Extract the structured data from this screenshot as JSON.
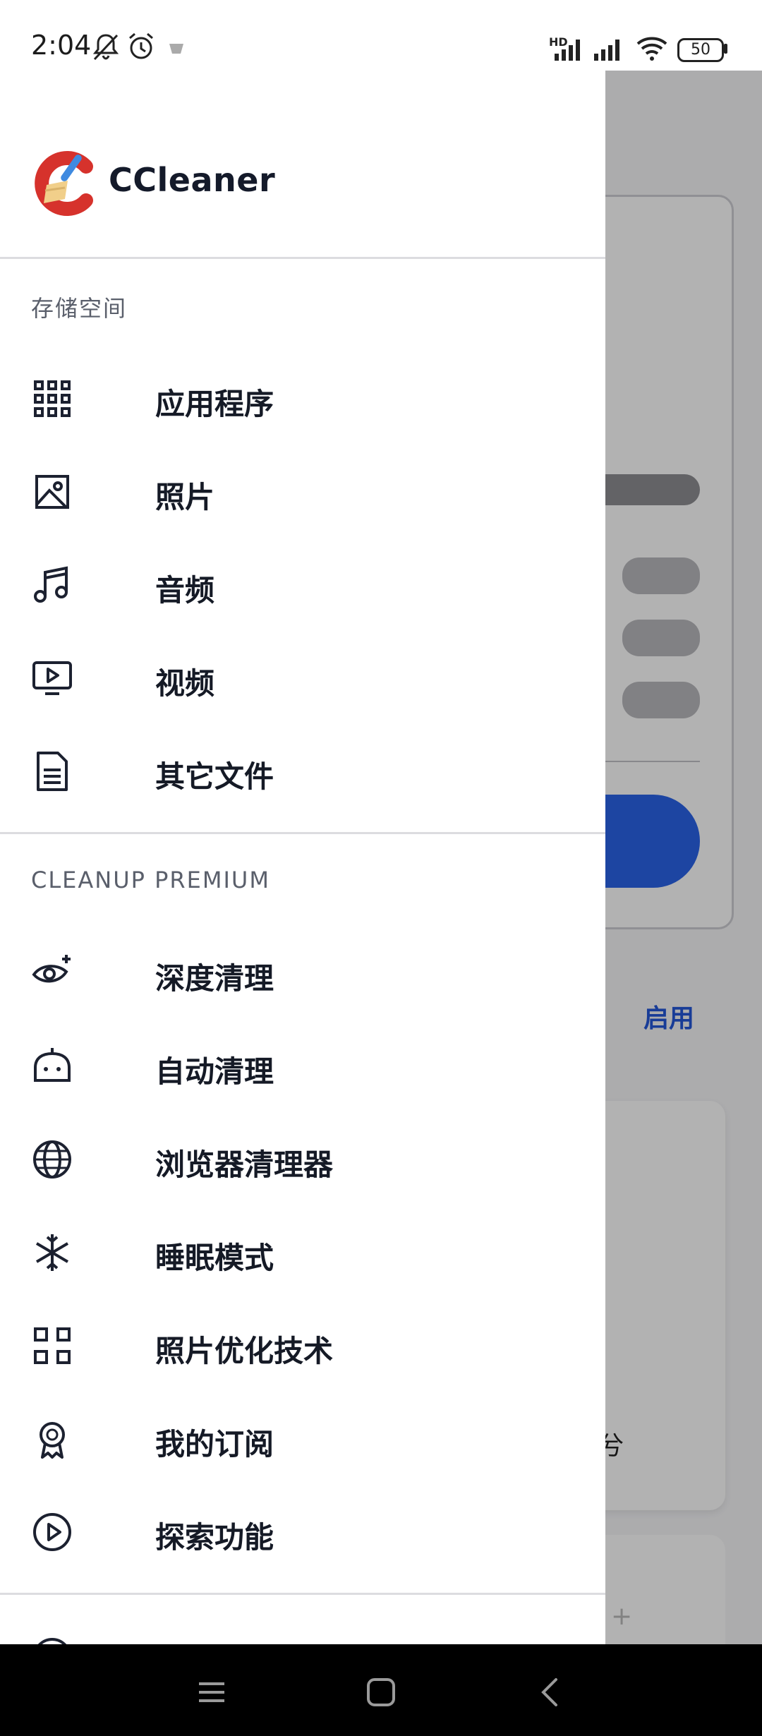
{
  "status_bar": {
    "time": "2:04",
    "battery_level": "50",
    "network_badge": "HD",
    "icons": [
      "bell-muted-icon",
      "alarm-icon",
      "notification-app-icon",
      "signal-hd-icon",
      "signal-icon",
      "wifi-icon",
      "battery-icon"
    ]
  },
  "drawer": {
    "brand": {
      "name": "CCleaner",
      "logo_icon": "ccleaner-logo-icon"
    },
    "sections": [
      {
        "title": "存储空间",
        "items": [
          {
            "label": "应用程序",
            "icon": "apps-grid-icon"
          },
          {
            "label": "照片",
            "icon": "photo-icon"
          },
          {
            "label": "音频",
            "icon": "music-note-icon"
          },
          {
            "label": "视频",
            "icon": "video-icon"
          },
          {
            "label": "其它文件",
            "icon": "document-icon"
          }
        ]
      },
      {
        "title": "CLEANUP PREMIUM",
        "items": [
          {
            "label": "深度清理",
            "icon": "eye-sparkle-icon"
          },
          {
            "label": "自动清理",
            "icon": "robot-icon"
          },
          {
            "label": "浏览器清理器",
            "icon": "globe-icon"
          },
          {
            "label": "睡眠模式",
            "icon": "snowflake-icon"
          },
          {
            "label": "照片优化技术",
            "icon": "photo-optimize-icon"
          },
          {
            "label": "我的订阅",
            "icon": "badge-icon"
          },
          {
            "label": "探索功能",
            "icon": "play-circle-icon"
          }
        ]
      }
    ]
  },
  "background": {
    "enable_link": "启用",
    "card_text_fragment": "兮"
  },
  "colors": {
    "accent_blue": "#2a63e8",
    "link_blue": "#2356d8",
    "logo_red": "#d6322c",
    "logo_blue": "#3f8ae0"
  }
}
